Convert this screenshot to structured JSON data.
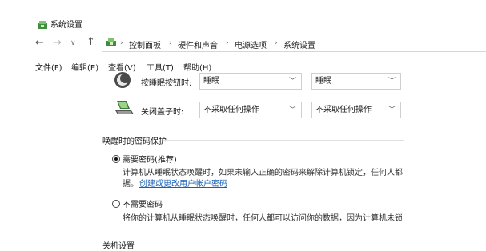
{
  "window": {
    "title": "系统设置",
    "icon": "control-panel-icon"
  },
  "nav": {
    "back": "←",
    "forward": "→",
    "recent": "∨",
    "up": "↑",
    "breadcrumbs": [
      "控制面板",
      "硬件和声音",
      "电源选项",
      "系统设置"
    ],
    "separator": "›"
  },
  "menu": [
    "文件(F)",
    "编辑(E)",
    "查看(V)",
    "工具(T)",
    "帮助(H)"
  ],
  "power_buttons": {
    "sleep_button_label": "按睡眠按钮时:",
    "sleep_on_battery": "睡眠",
    "sleep_plugged_in": "睡眠",
    "lid_label": "关闭盖子时:",
    "lid_on_battery": "不采取任何操作",
    "lid_plugged_in": "不采取任何操作"
  },
  "wake_password": {
    "section_title": "唤醒时的密码保护",
    "require_label": "需要密码(推荐)",
    "require_selected": true,
    "require_desc_1": "计算机从睡眠状态唤醒时，如果未输入正确的密码来解除计算机锁定，任何人都",
    "require_desc_2": "据。",
    "account_link": "创建或更改用户帐户密码",
    "no_require_label": "不需要密码",
    "no_require_desc": "将你的计算机从睡眠状态唤醒时，任何人都可以访问你的数据，因为计算机未锁"
  },
  "shutdown": {
    "section_title": "关机设置"
  },
  "colors": {
    "link": "#1a5fb4",
    "border": "#cfcfcf",
    "text": "#1a1a1a"
  }
}
